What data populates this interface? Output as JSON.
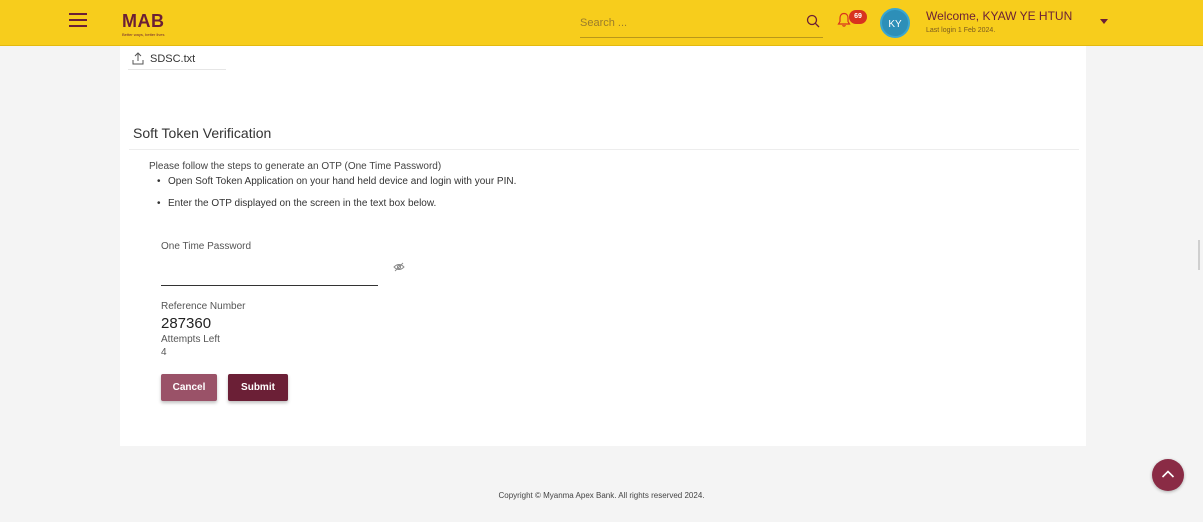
{
  "header": {
    "logo_text": "MAB",
    "logo_tagline": "Better ways, better lives",
    "search_placeholder": "Search ...",
    "notification_count": "69",
    "avatar_initials": "KY",
    "welcome_text": "Welcome, KYAW YE HTUN",
    "last_login_text": "Last login 1 Feb 2024."
  },
  "upload": {
    "file_name": "SDSC.txt"
  },
  "verification": {
    "title": "Soft Token Verification",
    "instructions": "Please follow the steps to generate an OTP (One Time Password)",
    "steps": [
      "Open Soft Token Application on your hand held device and login with your PIN.",
      "Enter the OTP displayed on the screen in the text box below."
    ],
    "otp_label": "One Time Password",
    "otp_value": "",
    "reference_label": "Reference Number",
    "reference_value": "287360",
    "attempts_label": "Attempts Left",
    "attempts_value": "4",
    "cancel_label": "Cancel",
    "submit_label": "Submit"
  },
  "footer": {
    "copyright": "Copyright © Myanma Apex Bank. All rights reserved 2024."
  },
  "colors": {
    "header_bg": "#f7cd1c",
    "brand_maroon": "#6b1f36",
    "badge_red": "#d8321f",
    "avatar_blue": "#2d8fb8"
  }
}
